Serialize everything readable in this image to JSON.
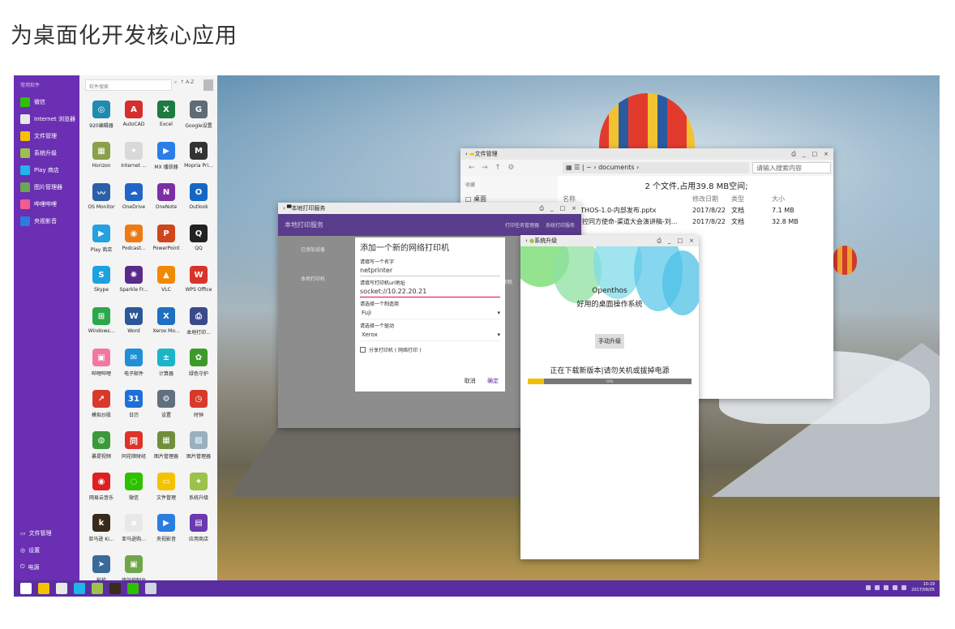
{
  "heading": "为桌面化开发核心应用",
  "startmenu": {
    "category": "常用软件",
    "items": [
      {
        "label": "微信",
        "color": "#2dc100"
      },
      {
        "label": "Internet 浏览器",
        "color": "#e8e8e8"
      },
      {
        "label": "文件管理",
        "color": "#f5c200"
      },
      {
        "label": "系统升级",
        "color": "#9bc24a"
      },
      {
        "label": "Play 商店",
        "color": "#1fb4ea"
      },
      {
        "label": "图片管理器",
        "color": "#6aa84f"
      },
      {
        "label": "哔哩哔哩",
        "color": "#f25d8e"
      },
      {
        "label": "央视影音",
        "color": "#2a7de1"
      }
    ],
    "bottom": [
      {
        "label": "文件管理",
        "icon": "folder-icon"
      },
      {
        "label": "设置",
        "icon": "gear-icon"
      },
      {
        "label": "电源",
        "icon": "power-icon"
      }
    ],
    "search_placeholder": "软件搜索",
    "sort_label": "A-Z",
    "apps": [
      {
        "label": "920编辑器",
        "color": "#1f8bb0",
        "glyph": "◎"
      },
      {
        "label": "AutoCAD",
        "color": "#d72d2d",
        "glyph": "A"
      },
      {
        "label": "Excel",
        "color": "#1d7a40",
        "glyph": "X"
      },
      {
        "label": "Google设置",
        "color": "#5e6c78",
        "glyph": "G"
      },
      {
        "label": "Horizon",
        "color": "#8aa04a",
        "glyph": "▦"
      },
      {
        "label": "Internet ...",
        "color": "#d9d9d9",
        "glyph": "✦"
      },
      {
        "label": "MX 播放器",
        "color": "#2b7de9",
        "glyph": "▶"
      },
      {
        "label": "Mopria Pri...",
        "color": "#333333",
        "glyph": "M"
      },
      {
        "label": "OS Monitor",
        "color": "#2b5fa8",
        "glyph": "〰"
      },
      {
        "label": "OneDrive",
        "color": "#2165c9",
        "glyph": "☁"
      },
      {
        "label": "OneNote",
        "color": "#7a2fa5",
        "glyph": "N"
      },
      {
        "label": "Outlook",
        "color": "#1468c4",
        "glyph": "O"
      },
      {
        "label": "Play 商店",
        "color": "#25a0e0",
        "glyph": "▶"
      },
      {
        "label": "Podcast...",
        "color": "#f07a12",
        "glyph": "◉"
      },
      {
        "label": "PowerPoint",
        "color": "#d0451b",
        "glyph": "P"
      },
      {
        "label": "QQ",
        "color": "#222222",
        "glyph": "Q"
      },
      {
        "label": "Skype",
        "color": "#1da1e0",
        "glyph": "S"
      },
      {
        "label": "Sparkle Fr...",
        "color": "#5a2a8a",
        "glyph": "✺"
      },
      {
        "label": "VLC",
        "color": "#f08a00",
        "glyph": "▲"
      },
      {
        "label": "WPS Office",
        "color": "#d8342c",
        "glyph": "W"
      },
      {
        "label": "Windows...",
        "color": "#2ca84a",
        "glyph": "⊞"
      },
      {
        "label": "Word",
        "color": "#2b579a",
        "glyph": "W"
      },
      {
        "label": "Xerox Mo...",
        "color": "#1f6fc0",
        "glyph": "X"
      },
      {
        "label": "本地打印...",
        "color": "#3a4a8a",
        "glyph": "⎙"
      },
      {
        "label": "哔哩哔哩",
        "color": "#f277a1",
        "glyph": "▣"
      },
      {
        "label": "电子邮件",
        "color": "#1e90d8",
        "glyph": "✉"
      },
      {
        "label": "计算器",
        "color": "#1bb4c8",
        "glyph": "±"
      },
      {
        "label": "绿色守护",
        "color": "#3c9a2a",
        "glyph": "✿"
      },
      {
        "label": "模拟炒股",
        "color": "#d83a2a",
        "glyph": "↗"
      },
      {
        "label": "日历",
        "color": "#1f6fd8",
        "glyph": "31"
      },
      {
        "label": "设置",
        "color": "#607080",
        "glyph": "⚙"
      },
      {
        "label": "时钟",
        "color": "#d83a2a",
        "glyph": "◷"
      },
      {
        "label": "暴提视频",
        "color": "#3a9a3a",
        "glyph": "◍"
      },
      {
        "label": "同花顺财经",
        "color": "#e0322a",
        "glyph": "同"
      },
      {
        "label": "图片管理器",
        "color": "#6f8f3a",
        "glyph": "▦"
      },
      {
        "label": "图片管理器",
        "color": "#9ab0c0",
        "glyph": "▨"
      },
      {
        "label": "网易云音乐",
        "color": "#e02020",
        "glyph": "◉"
      },
      {
        "label": "微信",
        "color": "#2dc100",
        "glyph": "◌"
      },
      {
        "label": "文件管理",
        "color": "#f5c200",
        "glyph": "▭"
      },
      {
        "label": "系统升级",
        "color": "#9bc24a",
        "glyph": "✦"
      },
      {
        "label": "亚马逊 Ki...",
        "color": "#3a2a1a",
        "glyph": "k"
      },
      {
        "label": "亚马逊购...",
        "color": "#e8e8e8",
        "glyph": "a"
      },
      {
        "label": "央视影音",
        "color": "#2a7de1",
        "glyph": "▶"
      },
      {
        "label": "应用商店",
        "color": "#6a3ab0",
        "glyph": "▤"
      },
      {
        "label": "影梭",
        "color": "#3a6a9a",
        "glyph": "➤"
      },
      {
        "label": "终端控制台",
        "color": "#6fa64a",
        "glyph": "▣"
      }
    ]
  },
  "filemanager": {
    "title": "文件管理",
    "path_home": "~",
    "path_folder": "documents",
    "search_placeholder": "请输入搜索内容",
    "side_label": "收藏",
    "side_desktop": "桌面",
    "summary": "2 个文件,占用39.8 MB空间;",
    "columns": [
      "名称",
      "修改日期",
      "类型",
      "大小"
    ],
    "rows": [
      [
        "OPENTHOS-1.0-内部发布.pptx",
        "2017/8/22",
        "文档",
        "7.1 MB"
      ],
      [
        "自主可控同方使命-渠道大会演讲稿-刘...",
        "2017/8/22",
        "文档",
        "32.8 MB"
      ]
    ]
  },
  "printservice": {
    "title": "本地打印服务",
    "header": "本地打印服务",
    "link1": "打印任务管理器",
    "link2": "系统打印服务",
    "side1": "已添加设备",
    "side2": "本地打印机",
    "dialog": {
      "title": "添加一个新的网络打印机",
      "name_label": "请填写一个名字",
      "name_value": "netprinter",
      "url_label": "请填写打印机url地址",
      "url_value": "socket://10.22.20.21",
      "maker_label": "请选择一个制造商",
      "maker_value": "Fuji",
      "driver_label": "请选择一个驱动",
      "driver_value": "Xerox",
      "share_label": "分享打印机 ( 网络打印 )",
      "cancel": "取消",
      "ok": "确定",
      "side_hint": "印机"
    }
  },
  "upgrade": {
    "title": "系统升级",
    "name": "Openthos",
    "tagline": "好用的桌面操作系统",
    "button": "手动升级",
    "status": "正在下载新版本|请勿关机或拔掉电源",
    "progress": 0.1,
    "progress_label": "10%"
  },
  "taskbar": {
    "time": "10:19",
    "date": "2017/09/05",
    "icons": [
      {
        "name": "launcher-icon",
        "color": "#ffffff"
      },
      {
        "name": "folder-icon",
        "color": "#f5c200"
      },
      {
        "name": "browser-icon",
        "color": "#e8e8e8"
      },
      {
        "name": "play-store-icon",
        "color": "#1fb4ea"
      },
      {
        "name": "android-icon",
        "color": "#9bc24a"
      },
      {
        "name": "kindle-icon",
        "color": "#3a2a1a"
      },
      {
        "name": "wechat-icon",
        "color": "#2dc100"
      },
      {
        "name": "printer-icon",
        "color": "#cfd6e0"
      }
    ]
  }
}
